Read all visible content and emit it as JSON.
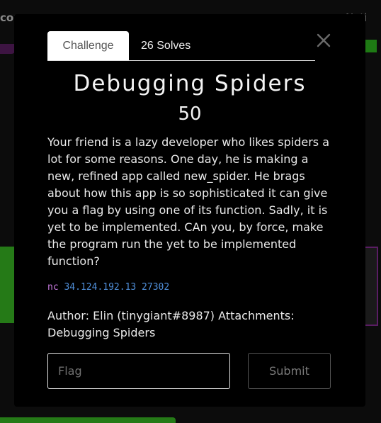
{
  "background": {
    "nav_left_text": "cor",
    "nav_right_text": "Noti"
  },
  "modal": {
    "tabs": [
      {
        "label": "Challenge",
        "active": true
      },
      {
        "label": "26 Solves",
        "active": false
      }
    ],
    "close_icon": "close-icon",
    "title": "Debugging Spiders",
    "points": "50",
    "description": "Your friend is a lazy developer who likes spiders a lot for some reasons. One day, he is making a new, refined app called new_spider. He brags about how this app is so sophisticated it can give you a flag by using one of its function. Sadly, it is yet to be implemented. CAn you, by force, make the program run the yet to be implemented function?",
    "code": {
      "command": "nc",
      "args": "34.124.192.13 27302"
    },
    "author_text": "Author: Elin (tinygiant#8987) Attachments: Debugging Spiders",
    "flag_input": {
      "value": "",
      "placeholder": "Flag"
    },
    "submit_label": "Submit"
  },
  "colors": {
    "modal_bg": "#000000",
    "text": "#f4f4f4",
    "code_command": "#c678dd",
    "code_args": "#4f8ed8",
    "bg_green": "#257a17",
    "bg_purple": "#5a1d63"
  }
}
